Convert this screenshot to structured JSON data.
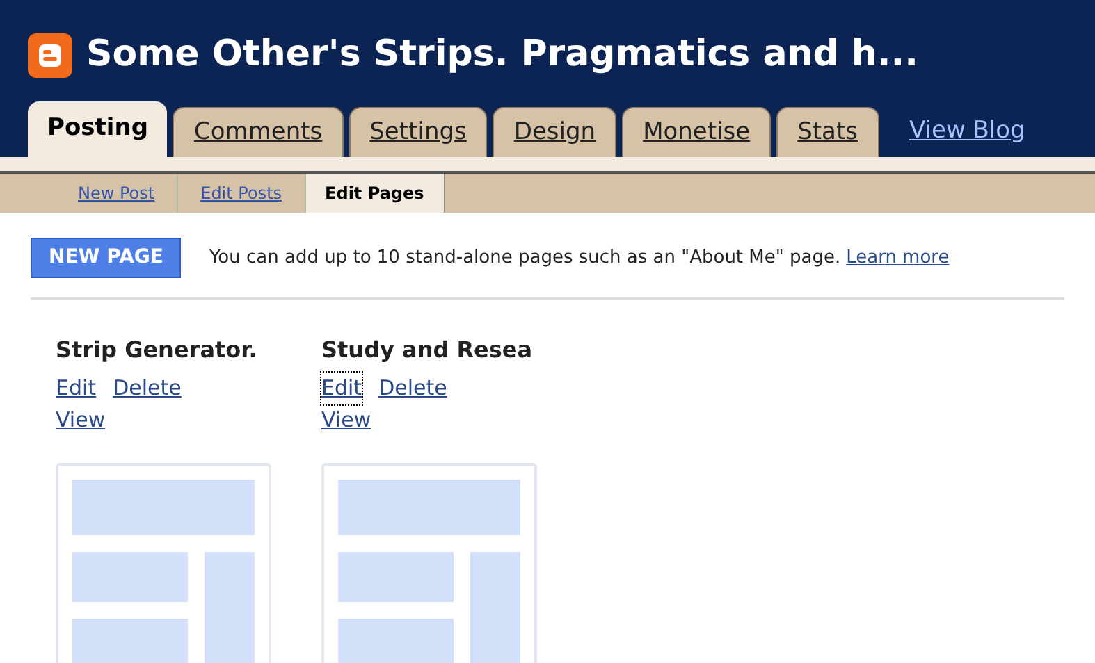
{
  "header": {
    "title": "Some Other's Strips. Pragmatics and h..."
  },
  "tabs": [
    {
      "label": "Posting",
      "selected": true
    },
    {
      "label": "Comments",
      "selected": false
    },
    {
      "label": "Settings",
      "selected": false
    },
    {
      "label": "Design",
      "selected": false
    },
    {
      "label": "Monetise",
      "selected": false
    },
    {
      "label": "Stats",
      "selected": false
    }
  ],
  "view_blog": "View Blog",
  "subtabs": [
    {
      "label": "New Post",
      "selected": false
    },
    {
      "label": "Edit Posts",
      "selected": false
    },
    {
      "label": "Edit Pages",
      "selected": true
    }
  ],
  "new_page_button": "NEW PAGE",
  "info": {
    "text": "You can add up to 10 stand-alone pages such as an \"About Me\" page.",
    "link": "Learn more"
  },
  "pages": [
    {
      "title": "Strip Generator.",
      "actions": [
        "Edit",
        "Delete"
      ],
      "view": "View",
      "focused": false
    },
    {
      "title": "Study and Resea",
      "actions": [
        "Edit",
        "Delete"
      ],
      "view": "View",
      "focused": true
    }
  ]
}
